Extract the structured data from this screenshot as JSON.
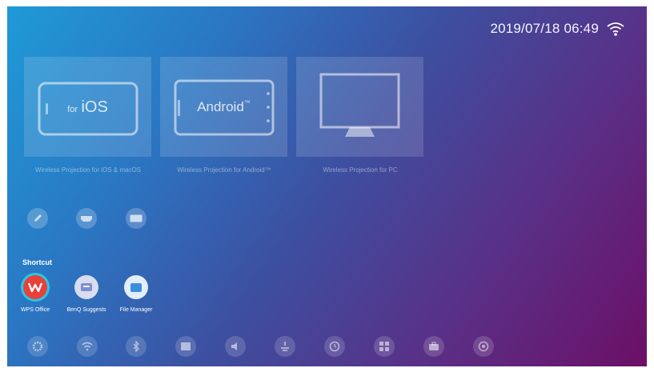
{
  "status": {
    "datetime": "2019/07/18 06:49",
    "wifi_icon": "wifi-icon"
  },
  "tiles": [
    {
      "title_small": "for",
      "title_big": "iOS",
      "caption": "Wireless Projection for iOS & macOS"
    },
    {
      "title_big": "Android",
      "title_tm": "™",
      "caption": "Wireless Projection for Android™"
    },
    {
      "caption": "Wireless Projection for PC"
    }
  ],
  "tools": [
    {
      "icon": "pencil-icon"
    },
    {
      "icon": "hdmi-icon"
    },
    {
      "icon": "keyboard-icon"
    }
  ],
  "shortcut": {
    "title": "Shortcut",
    "apps": [
      {
        "label": "WPS Office",
        "icon": "wps-office-icon",
        "color": "#e8403a"
      },
      {
        "label": "BenQ Suggests",
        "icon": "benq-suggests-icon",
        "color": "#7b8fd0"
      },
      {
        "label": "File Manager",
        "icon": "file-manager-icon",
        "color": "#3c8fd9"
      }
    ]
  },
  "dock": [
    {
      "icon": "settings-gear-icon"
    },
    {
      "icon": "wifi-settings-icon"
    },
    {
      "icon": "bluetooth-icon"
    },
    {
      "icon": "picture-icon"
    },
    {
      "icon": "sound-icon"
    },
    {
      "icon": "brightness-icon"
    },
    {
      "icon": "clock-icon"
    },
    {
      "icon": "apps-grid-icon"
    },
    {
      "icon": "briefcase-icon"
    },
    {
      "icon": "target-icon"
    }
  ]
}
